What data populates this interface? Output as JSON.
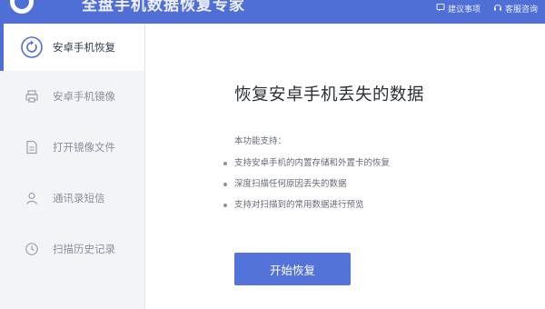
{
  "app": {
    "title": "全盘手机数据恢复专家"
  },
  "header_actions": [
    {
      "label": "建议事项",
      "icon": "feedback-icon"
    },
    {
      "label": "客服咨询",
      "icon": "headset-icon"
    }
  ],
  "sidebar": {
    "items": [
      {
        "label": "安卓手机恢复",
        "icon": "recovery-icon",
        "active": true
      },
      {
        "label": "安卓手机镜像",
        "icon": "printer-icon",
        "active": false
      },
      {
        "label": "打开镜像文件",
        "icon": "document-icon",
        "active": false
      },
      {
        "label": "通讯录短信",
        "icon": "contact-icon",
        "active": false
      },
      {
        "label": "扫描历史记录",
        "icon": "history-icon",
        "active": false
      }
    ]
  },
  "main": {
    "heading": "恢复安卓手机丢失的数据",
    "features_title": "本功能支持：",
    "features": [
      "支持安卓手机的内置存储和外置卡的恢复",
      "深度扫描任何原因丢失的数据",
      "支持对扫描到的常用数据进行预览"
    ],
    "start_button": "开始恢复"
  },
  "colors": {
    "accent": "#4f6fd6",
    "button": "#5373d8",
    "sidebar_bg": "#f3f4f8"
  }
}
